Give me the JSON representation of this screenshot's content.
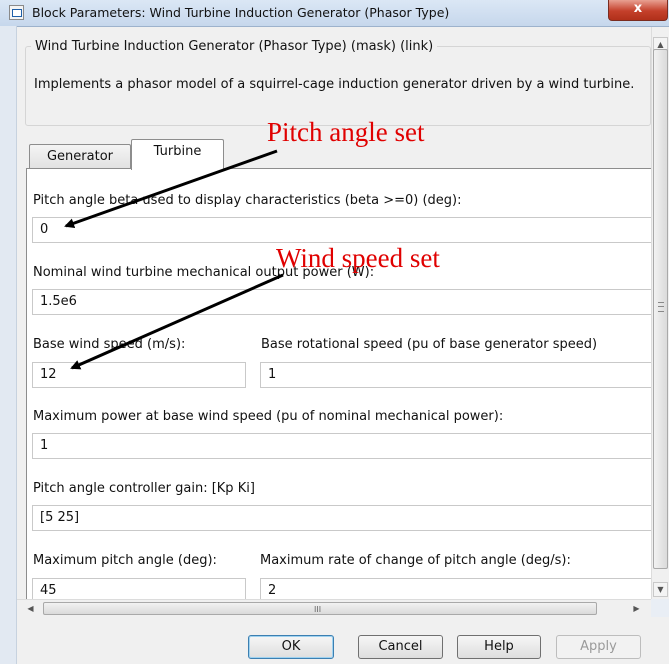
{
  "window": {
    "title": "Block Parameters: Wind Turbine Induction Generator (Phasor Type)",
    "close_label": "x"
  },
  "group": {
    "title": "Wind Turbine Induction Generator (Phasor Type) (mask) (link)",
    "description": "Implements a phasor model of a squirrel-cage induction generator driven by a wind turbine."
  },
  "tabs": [
    {
      "label": "Generator",
      "selected": false
    },
    {
      "label": "Turbine",
      "selected": true
    }
  ],
  "params": {
    "pitch_beta": {
      "label": "Pitch angle beta used to display characteristics (beta >=0)  (deg):",
      "value": "0"
    },
    "nominal_power": {
      "label": "Nominal wind turbine mechanical output power (W):",
      "value": "1.5e6"
    },
    "base_wind_speed": {
      "label": "Base wind speed (m/s):",
      "value": "12"
    },
    "base_rot_speed": {
      "label": "Base rotational speed (pu of base generator speed)",
      "value": "1"
    },
    "max_power": {
      "label": "Maximum power at base wind speed (pu of nominal mechanical power):",
      "value": "1"
    },
    "pitch_gain": {
      "label": "Pitch angle controller gain: [Kp Ki]",
      "value": "[5 25]"
    },
    "max_pitch": {
      "label": "Maximum pitch angle (deg):",
      "value": "45"
    },
    "max_rate": {
      "label": "Maximum rate of change of pitch angle (deg/s):",
      "value": "2"
    }
  },
  "annotations": {
    "pitch_label": "Pitch angle set",
    "wind_label": "Wind speed set",
    "color": "#e00000"
  },
  "buttons": {
    "ok": "OK",
    "cancel": "Cancel",
    "help": "Help",
    "apply": "Apply"
  },
  "scrollbar": {
    "vgrip": "≡",
    "hgrip": "III",
    "up": "▲",
    "down": "▼",
    "left": "◀",
    "right": "▶"
  }
}
